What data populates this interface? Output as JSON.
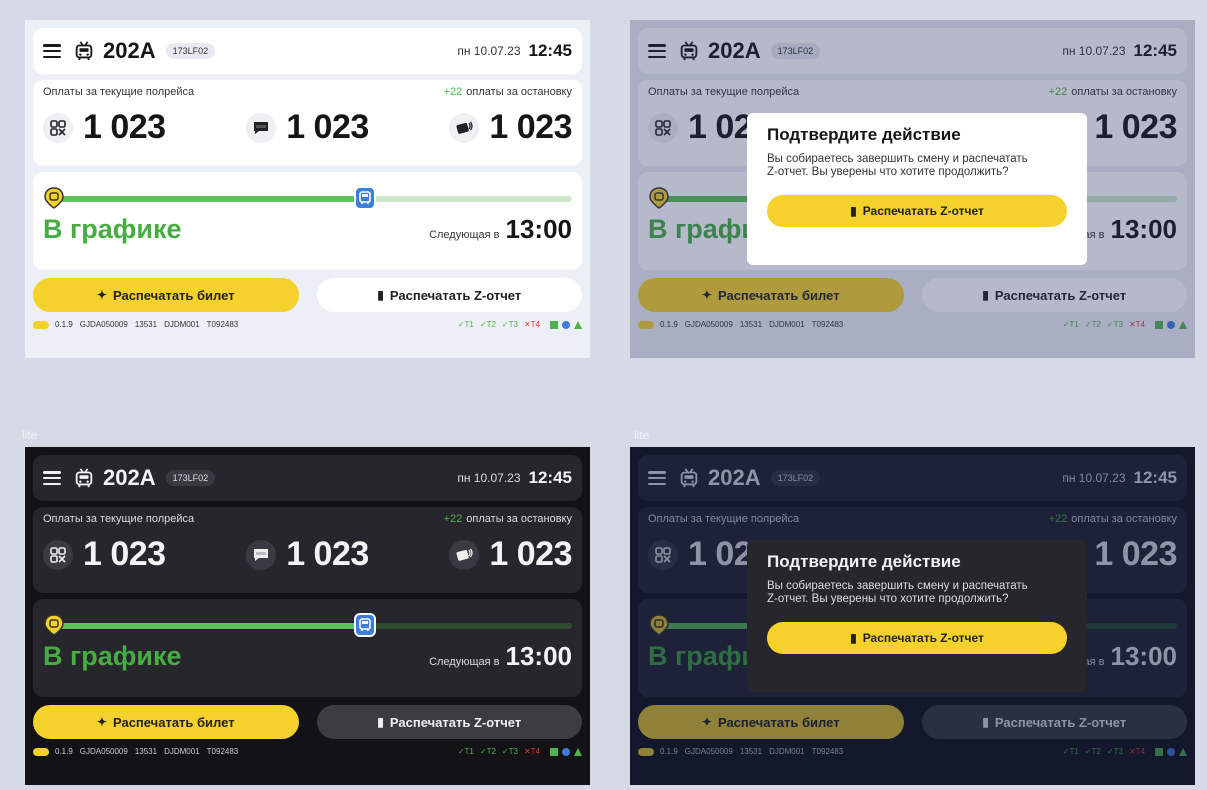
{
  "watermark": "lite",
  "header": {
    "route": "202A",
    "vehicle_id": "173LF02",
    "date": "пн 10.07.23",
    "time": "12:45"
  },
  "payments": {
    "title": "Оплаты за текущие полрейса",
    "stop_increment": "+22",
    "stop_label": "оплаты за остановку",
    "items": [
      {
        "icon": "qr-code-icon",
        "value": "1 023"
      },
      {
        "icon": "sms-icon",
        "value": "1 023"
      },
      {
        "icon": "card-icon",
        "value": "1 023"
      }
    ]
  },
  "schedule": {
    "progress": 0.6,
    "status": "В графике",
    "next_label": "Следующая в",
    "next_time": "13:00"
  },
  "buttons": {
    "print_ticket": "Распечатать билет",
    "print_z_report": "Распечатать Z-отчет"
  },
  "footer": {
    "items": [
      "0.1.9",
      "GJDA050009",
      "13531",
      "DJDM001",
      "T092483"
    ],
    "terminals_ok": [
      "T1",
      "T2",
      "T3"
    ],
    "terminals_fail": [
      "T4"
    ]
  },
  "modal": {
    "title": "Подтвердите действие",
    "text": "Вы собираетесь завершить смену и распечатать Z-отчет. Вы уверены что хотите продолжить?",
    "button": "Распечатать Z-отчет"
  },
  "colors": {
    "accent_yellow": "#f4d12b",
    "status_green": "#47ad43",
    "bus_blue": "#3d7ddb",
    "error_red": "#e33a3a"
  }
}
